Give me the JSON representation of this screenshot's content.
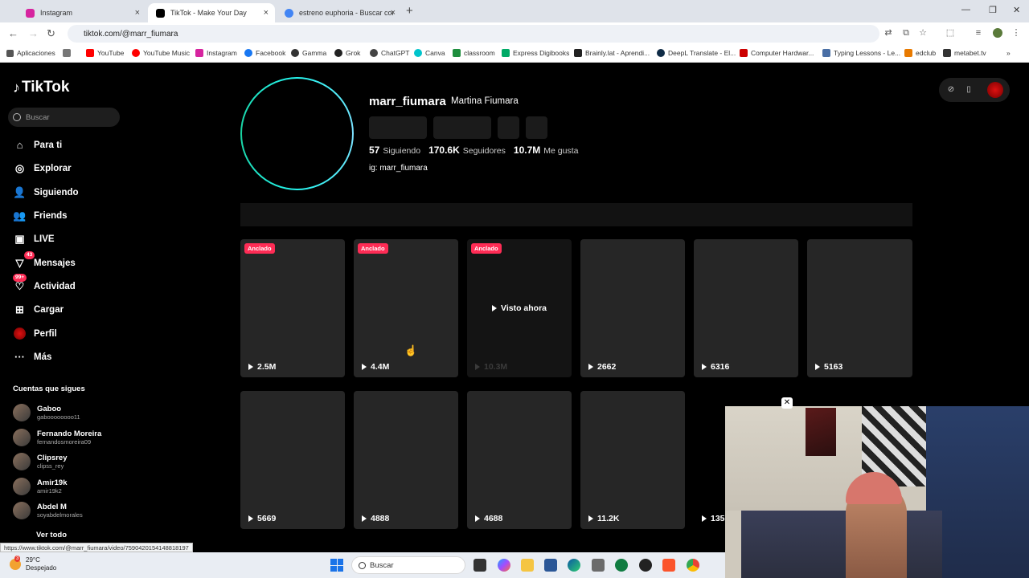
{
  "browser": {
    "tabs": [
      {
        "title": "Instagram",
        "color": "#d6249f"
      },
      {
        "title": "TikTok - Make Your Day",
        "color": "#000000"
      },
      {
        "title": "estreno euphoria - Buscar con G",
        "color": "#4285f4"
      }
    ],
    "new_tab": "+",
    "url": "tiktok.com/@marr_fiumara",
    "bookmarks": [
      "Aplicaciones",
      "YouTube",
      "YouTube Music",
      "Instagram",
      "Facebook",
      "Gamma",
      "Grok",
      "ChatGPT",
      "Canva",
      "classroom",
      "Express Digibooks",
      "Brainly.lat - Aprendi...",
      "DeepL Translate - El...",
      "Computer Hardwar...",
      "Typing Lessons - Le...",
      "edclub",
      "metabet.tv"
    ]
  },
  "sidebar": {
    "logo": "TikTok",
    "search_placeholder": "Buscar",
    "items": [
      {
        "label": "Para ti",
        "icon": "home-icon"
      },
      {
        "label": "Explorar",
        "icon": "compass-icon"
      },
      {
        "label": "Siguiendo",
        "icon": "following-icon"
      },
      {
        "label": "Friends",
        "icon": "friends-icon"
      },
      {
        "label": "LIVE",
        "icon": "live-icon"
      },
      {
        "label": "Mensajes",
        "icon": "messages-icon",
        "badge": "43"
      },
      {
        "label": "Actividad",
        "icon": "activity-icon",
        "badge": "99+"
      },
      {
        "label": "Cargar",
        "icon": "upload-icon"
      },
      {
        "label": "Perfil",
        "icon": "profile-icon"
      },
      {
        "label": "Más",
        "icon": "more-icon"
      }
    ],
    "following_title": "Cuentas que sigues",
    "accounts": [
      {
        "name": "Gaboo",
        "handle": "gaboooooooo11"
      },
      {
        "name": "Fernando Moreira",
        "handle": "fernandosmoreira09"
      },
      {
        "name": "Clipsrey",
        "handle": "clipss_rey"
      },
      {
        "name": "Amir19k",
        "handle": "amir19k2"
      },
      {
        "name": "Abdel M",
        "handle": "soyabdelmorales"
      }
    ],
    "see_all": "Ver todo"
  },
  "profile": {
    "username": "marr_fiumara",
    "display_name": "Martina Fiumara",
    "following_count": "57",
    "following_label": "Siguiendo",
    "followers_count": "170.6K",
    "followers_label": "Seguidores",
    "likes_count": "10.7M",
    "likes_label": "Me gusta",
    "bio": "ig: marr_fiumara"
  },
  "videos": [
    {
      "views": "2.5M",
      "pinned": "Anclado"
    },
    {
      "views": "4.4M",
      "pinned": "Anclado"
    },
    {
      "views": "10.3M",
      "pinned": "Anclado",
      "overlay": "Visto ahora"
    },
    {
      "views": "2662"
    },
    {
      "views": "6316"
    },
    {
      "views": "5163"
    },
    {
      "views": "5669"
    },
    {
      "views": "4888"
    },
    {
      "views": "4688"
    },
    {
      "views": "11.2K"
    },
    {
      "views": "135"
    }
  ],
  "status_url": "https://www.tiktok.com/@marr_fiumara/video/7590420154148818197",
  "taskbar": {
    "temperature": "29°C",
    "weather": "Despejado",
    "weather_badge": "3",
    "search": "Buscar"
  }
}
